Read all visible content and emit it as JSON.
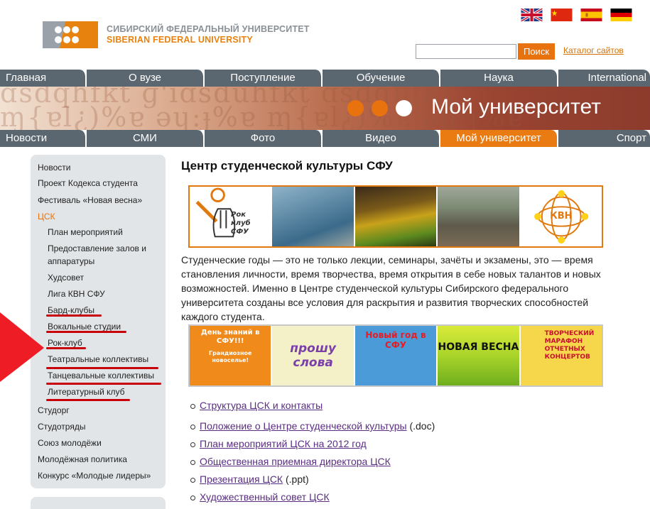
{
  "header": {
    "logo_line1": "СИБИРСКИЙ ФЕДЕРАЛЬНЫЙ УНИВЕРСИТЕТ",
    "logo_line2": "SIBERIAN FEDERAL UNIVERSITY",
    "search_button": "Поиск",
    "search_value": "",
    "catalog_link": "Каталог сайтов",
    "flags": [
      "uk-flag-icon",
      "china-flag-icon",
      "spain-flag-icon",
      "germany-flag-icon"
    ]
  },
  "nav_top": [
    "Главная",
    "О вузе",
    "Поступление",
    "Обучение",
    "Наука",
    "International"
  ],
  "banner": {
    "title": "Мой университет"
  },
  "nav_bottom": [
    "Новости",
    "СМИ",
    "Фото",
    "Видео",
    "Мой университет",
    "Спорт"
  ],
  "nav_bottom_active": "Мой университет",
  "sidebar": {
    "items": [
      {
        "label": "Новости"
      },
      {
        "label": "Проект Кодекса студента"
      },
      {
        "label": "Фестиваль «Новая весна»"
      },
      {
        "label": "ЦСК"
      },
      {
        "label": "План мероприятий"
      },
      {
        "label": "Предоставление залов и"
      },
      {
        "label": "аппаратуры"
      },
      {
        "label": "Худсовет"
      },
      {
        "label": "Лига КВН СФУ"
      },
      {
        "label": "Бард-клубы"
      },
      {
        "label": "Вокальные студии"
      },
      {
        "label": "Рок-клуб"
      },
      {
        "label": "Театральные коллективы"
      },
      {
        "label": "Танцевальные коллективы"
      },
      {
        "label": "Литературный клуб"
      },
      {
        "label": "Студорг"
      },
      {
        "label": "Студотряды"
      },
      {
        "label": "Союз молодёжи"
      },
      {
        "label": "Молодёжная политика"
      },
      {
        "label": "Конкурс «Молодые лидеры»"
      }
    ]
  },
  "content": {
    "title": "Центр студенческой культуры СФУ",
    "photo_labels": {
      "rock_club": "Рок клуб СФУ",
      "kvn": "КВН"
    },
    "poster_labels": {
      "p1": "День знаний в СФУ!!!",
      "p1_sub": "Грандиозное новоселье!",
      "p2": "прошу слова",
      "p3": "Новый год в СФУ",
      "p4": "НОВАЯ ВЕСНА",
      "p5": "ТВОРЧЕСКИЙ МАРАФОН ОТЧЕТНЫХ КОНЦЕРТОВ"
    },
    "intro": "Студенческие годы — это не только лекции, семинары, зачёты и экзамены, это — время становления личности, время творчества, время открытия в себе новых талантов и новых возможностей. Именно в Центре студенческой культуры Сибирского федерального университета созданы все условия для раскрытия и развития творческих способностей каждого студента.",
    "links": [
      {
        "text": "Структура ЦСК и контакты",
        "suffix": ""
      },
      {
        "text": "Положение о Центре студенческой культуры",
        "suffix": " (.doc)"
      },
      {
        "text": "План мероприятий ЦСК на 2012 год",
        "suffix": ""
      },
      {
        "text": "Общественная приемная директора ЦСК",
        "suffix": ""
      },
      {
        "text": "Презентация ЦСК",
        "suffix": " (.ppt)"
      },
      {
        "text": "Художественный совет ЦСК",
        "suffix": ""
      }
    ]
  },
  "colors": {
    "accent": "#e8720e",
    "nav": "#5a6670",
    "annotation": "#c8000a",
    "link": "#5a2d82"
  }
}
